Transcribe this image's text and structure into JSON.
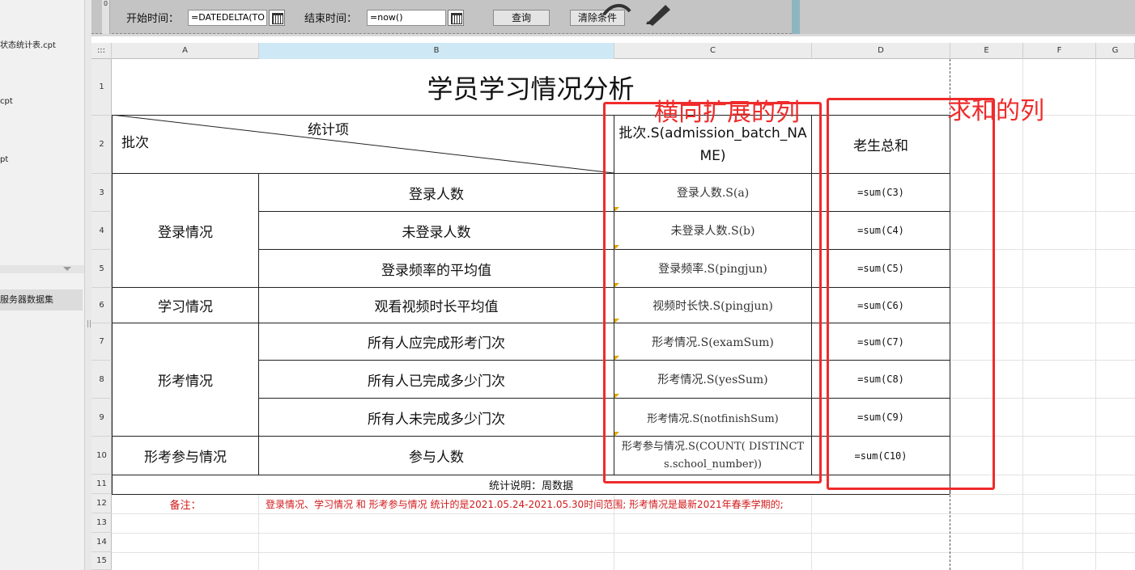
{
  "left_panel": {
    "files": [
      "状态统计表.cpt",
      "cpt",
      "pt"
    ],
    "server_dataset": "服务器数据集"
  },
  "params": {
    "ruler_label": "0",
    "start_label": "开始时间：",
    "start_value": "=DATEDELTA(TO",
    "end_label": "结束时间：",
    "end_value": "=now()",
    "query_button": "查询",
    "clear_button": "清除条件"
  },
  "grid": {
    "corner": ":::",
    "columns": [
      "A",
      "B",
      "C",
      "D",
      "E",
      "F",
      "G"
    ],
    "rows": [
      "1",
      "2",
      "3",
      "4",
      "5",
      "6",
      "7",
      "8",
      "9",
      "10",
      "11",
      "12",
      "13",
      "14",
      "15"
    ]
  },
  "report": {
    "title": "学员学习情况分析",
    "header_diag_top": "统计项",
    "header_diag_left": "批次",
    "header_c": "批次.S(admission_batch_NAME)",
    "header_d": "老生总和",
    "groups": {
      "login": "登录情况",
      "study": "学习情况",
      "exam": "形考情况",
      "participation": "形考参与情况"
    },
    "items": [
      {
        "label": "登录人数",
        "expr": "登录人数.S(a)",
        "sum": "=sum(C3)"
      },
      {
        "label": "未登录人数",
        "expr": "未登录人数.S(b)",
        "sum": "=sum(C4)"
      },
      {
        "label": "登录频率的平均值",
        "expr": "登录频率.S(pingjun)",
        "sum": "=sum(C5)"
      },
      {
        "label": "观看视频时长平均值",
        "expr": "视频时长快.S(pingjun)",
        "sum": "=sum(C6)"
      },
      {
        "label": "所有人应完成形考门次",
        "expr": "形考情况.S(examSum)",
        "sum": "=sum(C7)"
      },
      {
        "label": "所有人已完成多少门次",
        "expr": "形考情况.S(yesSum)",
        "sum": "=sum(C8)"
      },
      {
        "label": "所有人未完成多少门次",
        "expr": "形考情况.S(notfinishSum)",
        "sum": "=sum(C9)"
      },
      {
        "label": "参与人数",
        "expr": "形考参与情况.S(COUNT( DISTINCT s.school_number))",
        "sum": "=sum(C10)"
      }
    ],
    "footer_note": "统计说明：周数据",
    "remark_label": "备注：",
    "remark_text": "登录情况、学习情况 和 形考参与情况 统计的是2021.05.24-2021.05.30时间范围;      形考情况是最新2021年春季学期的;"
  },
  "annotations": {
    "horizontal_expand": "横向扩展的列",
    "sum_column": "求和的列",
    "color": "#ef2b2b"
  }
}
